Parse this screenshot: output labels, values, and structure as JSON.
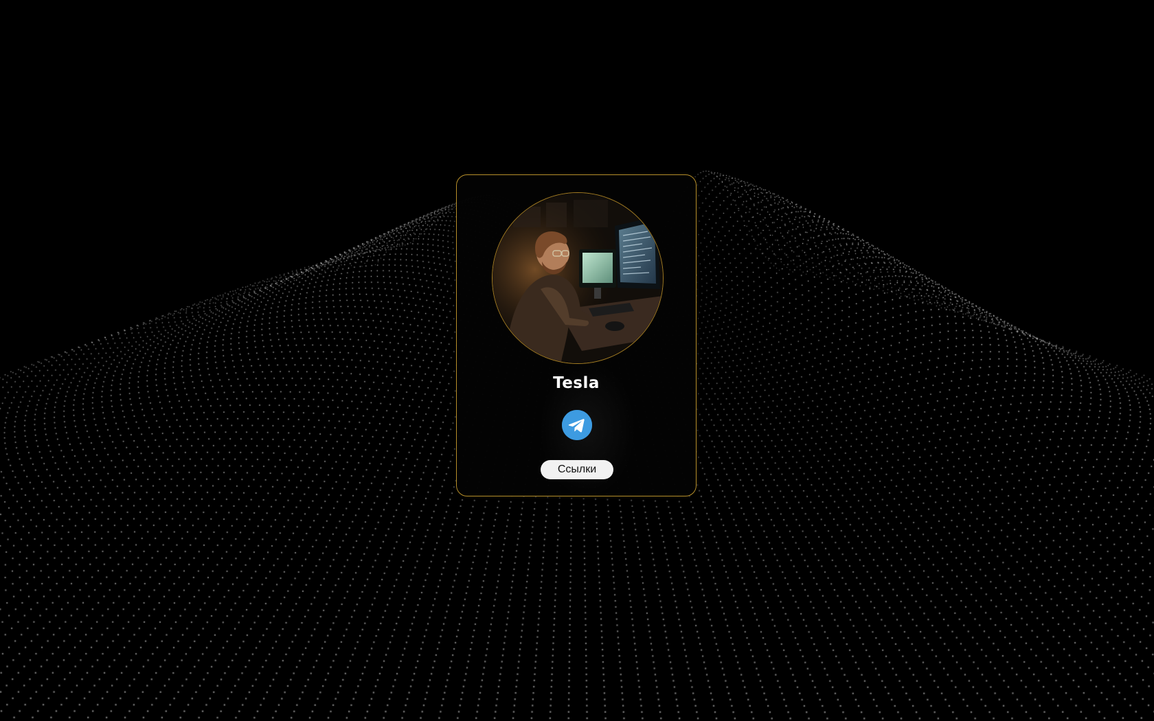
{
  "profile": {
    "name": "Tesla",
    "links_button_label": "Ссылки"
  },
  "icons": {
    "social": "telegram-icon",
    "avatar": "avatar"
  },
  "colors": {
    "background": "#000000",
    "card_border": "#b8902a",
    "telegram_blue": "#3d9be1",
    "button_bg": "#f2f2f2",
    "particles": "#ffffff"
  }
}
